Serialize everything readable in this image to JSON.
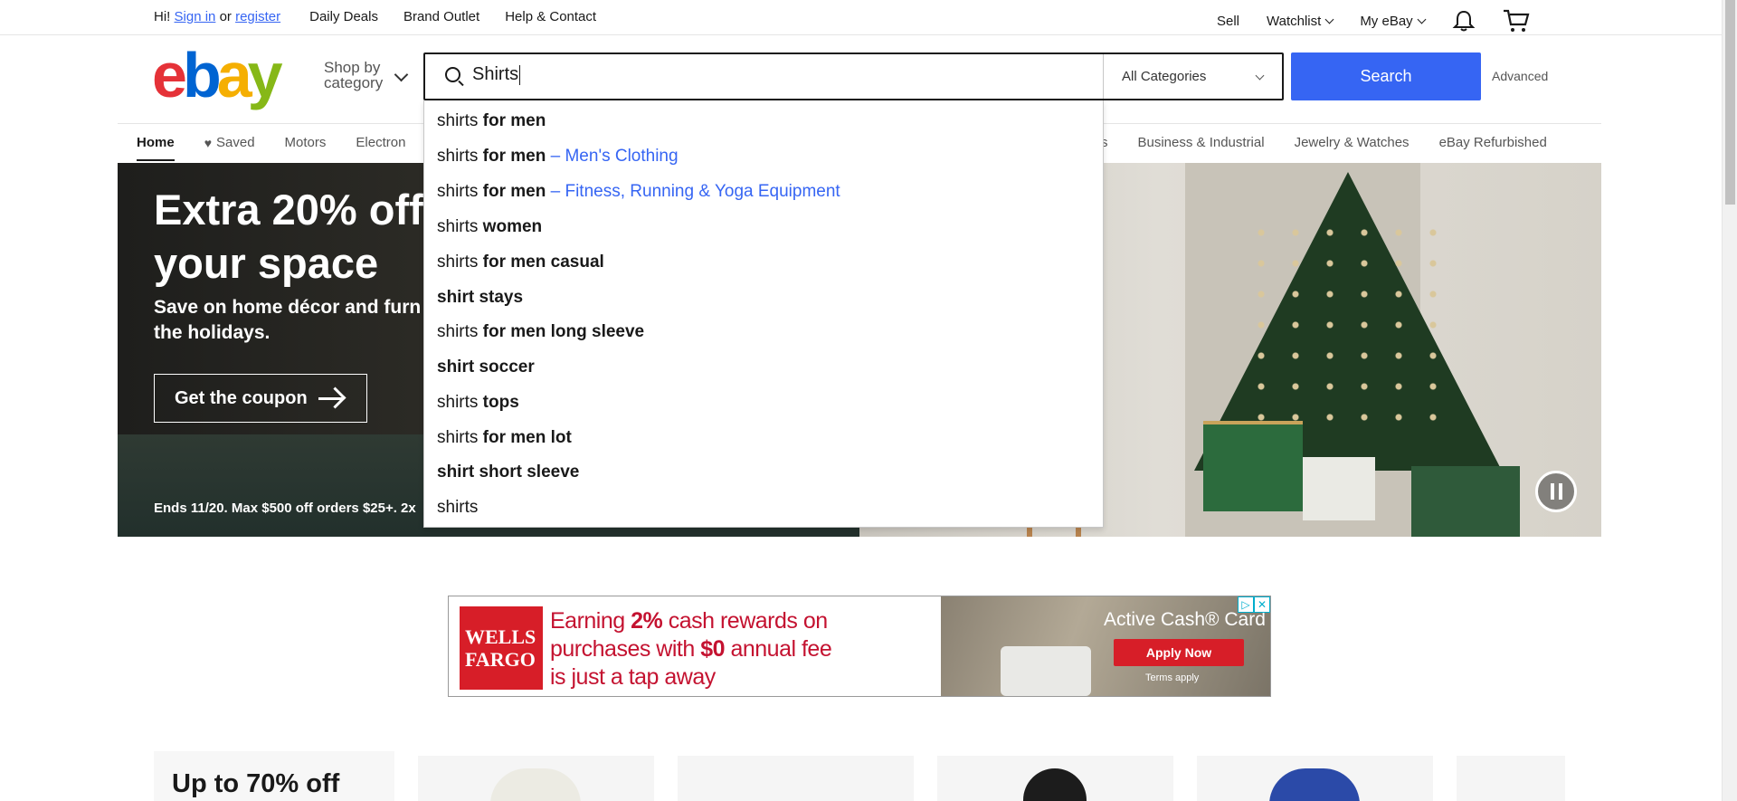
{
  "topbar": {
    "greeting": "Hi!",
    "sign_in": "Sign in",
    "or": "or",
    "register": "register",
    "links": [
      "Daily Deals",
      "Brand Outlet",
      "Help & Contact"
    ],
    "sell": "Sell",
    "watchlist": "Watchlist",
    "my_ebay": "My eBay"
  },
  "header": {
    "logo": [
      "e",
      "b",
      "a",
      "y"
    ],
    "shop_by": "Shop by",
    "category": "category",
    "search_value": "Shirts",
    "category_select": "All Categories",
    "search_button": "Search",
    "advanced": "Advanced"
  },
  "nav": {
    "home": "Home",
    "saved": "Saved",
    "motors": "Motors",
    "electronics_partial": "Electron",
    "hidden_partial": "s",
    "right": [
      "Business & Industrial",
      "Jewelry & Watches",
      "eBay Refurbished"
    ]
  },
  "autocomplete": [
    {
      "q": "shirts",
      "b": " for men",
      "cat": ""
    },
    {
      "q": "shirts",
      "b": " for men",
      "cat": " – Men's Clothing"
    },
    {
      "q": "shirts",
      "b": " for men",
      "cat": " – Fitness, Running & Yoga Equipment"
    },
    {
      "q": "shirts",
      "b": " women",
      "cat": ""
    },
    {
      "q": "shirts",
      "b": " for men casual",
      "cat": ""
    },
    {
      "q": "",
      "b": "shirt stays",
      "cat": ""
    },
    {
      "q": "shirts",
      "b": " for men long sleeve",
      "cat": ""
    },
    {
      "q": "",
      "b": "shirt soccer",
      "cat": ""
    },
    {
      "q": "shirts",
      "b": " tops",
      "cat": ""
    },
    {
      "q": "shirts",
      "b": " for men lot",
      "cat": ""
    },
    {
      "q": "",
      "b": "shirt short sleeve",
      "cat": ""
    },
    {
      "q": "shirts",
      "b": "",
      "cat": ""
    }
  ],
  "hero": {
    "title_line1": "Extra 20% off",
    "title_line2": "your space",
    "subtitle_line1": "Save on home décor and furn",
    "subtitle_line2": "the holidays.",
    "button": "Get the coupon",
    "fine_print": "Ends 11/20. Max $500 off orders $25+. 2x"
  },
  "ad": {
    "brand_line1": "WELLS",
    "brand_line2": "FARGO",
    "text_line1_a": "Earning ",
    "text_line1_b": "2%",
    "text_line1_c": " cash rewards on",
    "text_line2_a": "purchases with ",
    "text_line2_b": "$0",
    "text_line2_c": " annual fee",
    "text_line3": "is just a tap away",
    "card_title": "Active Cash® Card",
    "apply": "Apply Now",
    "terms": "Terms apply"
  },
  "promo": {
    "title": "Up to 70% off"
  },
  "colors": {
    "accent": "#3665f3",
    "wf_red": "#d71e28"
  }
}
